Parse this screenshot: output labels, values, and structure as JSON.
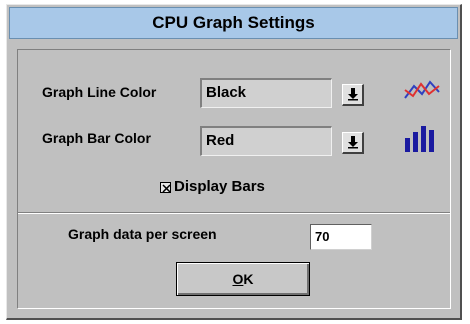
{
  "window": {
    "title": "CPU Graph Settings"
  },
  "line_color": {
    "label": "Graph Line Color",
    "value": "Black",
    "icon": "line-graph-icon"
  },
  "bar_color": {
    "label": "Graph Bar Color",
    "value": "Red",
    "icon": "bar-graph-icon",
    "icon_color": "#1a1aa0"
  },
  "display_bars": {
    "label": "Display Bars",
    "checked": true
  },
  "data_per_screen": {
    "label": "Graph data per screen",
    "value": "70"
  },
  "ok_button": {
    "underlined": "O",
    "rest": "K"
  }
}
